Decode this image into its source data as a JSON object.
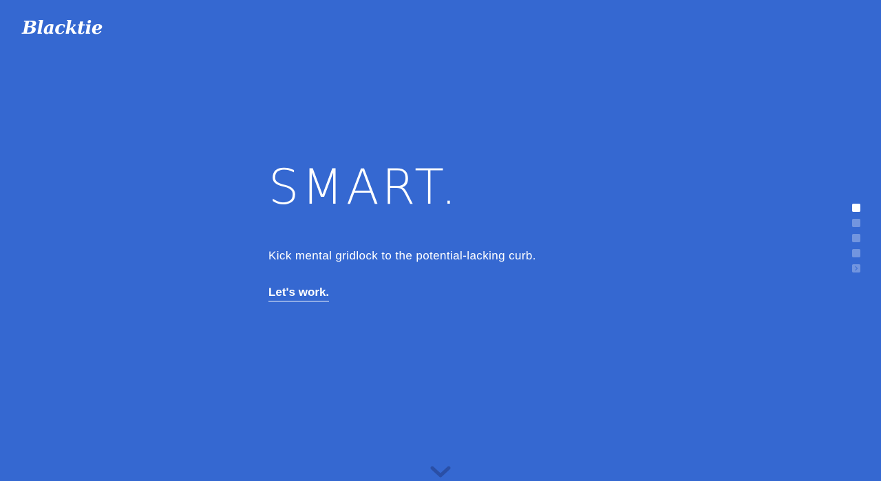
{
  "header": {
    "logo_text": "Blacktie"
  },
  "hero": {
    "headline": "SMART.",
    "tagline": "Kick mental gridlock to the potential-lacking curb.",
    "cta_label": "Let's work."
  },
  "pagination": {
    "count": 5,
    "active_index": 0
  },
  "icons": {
    "scroll": "chevron-down-icon",
    "last_dot": "chevron-right-icon"
  },
  "colors": {
    "background": "#3568d1",
    "text": "#ffffff",
    "scroll_chevron": "#2a4fa6"
  }
}
